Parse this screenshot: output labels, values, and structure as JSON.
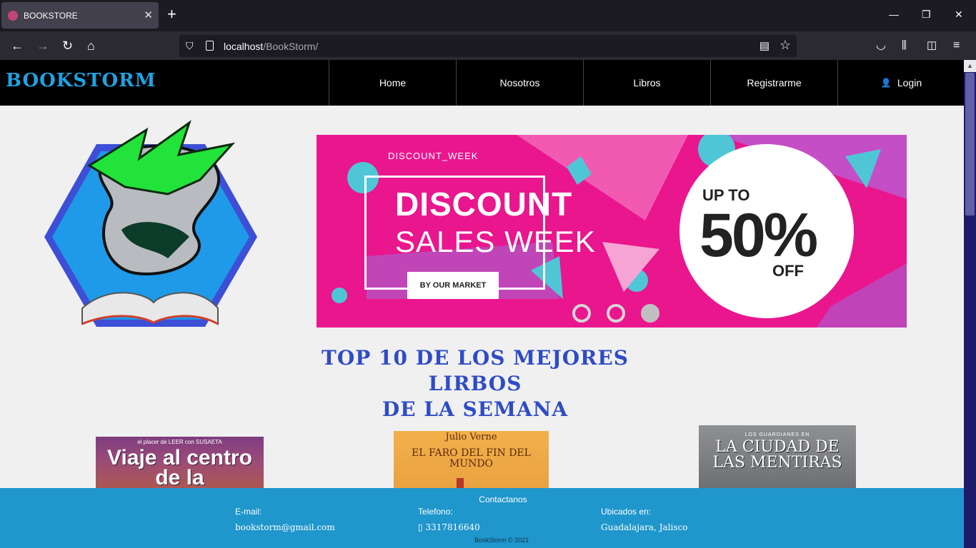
{
  "browser": {
    "tab_title": "BOOKSTORE",
    "tab_close": "✕",
    "new_tab": "+",
    "url_host": "localhost",
    "url_path": "/BookStorm/",
    "window_controls": [
      "—",
      "❐",
      "✕"
    ]
  },
  "header": {
    "brand": "BOOKSTORM",
    "menu": [
      "Home",
      "Nosotros",
      "Libros",
      "Registrarme"
    ],
    "login": "Login"
  },
  "banner": {
    "social_handle": "DISCOUNT_WEEK",
    "line1": "DISCOUNT",
    "line2": "SALES WEEK",
    "button": "BY OUR MARKET",
    "up_to": "UP TO",
    "percent": "50%",
    "off": "OFF",
    "slides": 3,
    "active_slide": 3
  },
  "section": {
    "title_line1": "Top 10 de los mejores lirbos",
    "title_line2": "de la semana"
  },
  "books": [
    {
      "top": "el placer de LEER con SUSAETA",
      "title": "Viaje al centro de la"
    },
    {
      "author": "Julio Verne",
      "title": "EL FARO DEL FIN DEL MUNDO"
    },
    {
      "series": "LOS GUARDIANES EN",
      "title": "LA CIUDAD DE LAS MENTIRAS"
    }
  ],
  "footer": {
    "heading": "Contactanos",
    "email_label": "E-mail:",
    "email": "bookstorm@gmail.com",
    "phone_label": "Telefono:",
    "phone": "▯ 3317816640",
    "location_label": "Ubicados en:",
    "location": "Guadalajara, Jalisco",
    "copyright": "BookStorm © 2021"
  },
  "colors": {
    "brand": "#1fa2e0",
    "title": "#2f4cc4",
    "footer": "#1f96cc",
    "banner": "#e9168e"
  }
}
